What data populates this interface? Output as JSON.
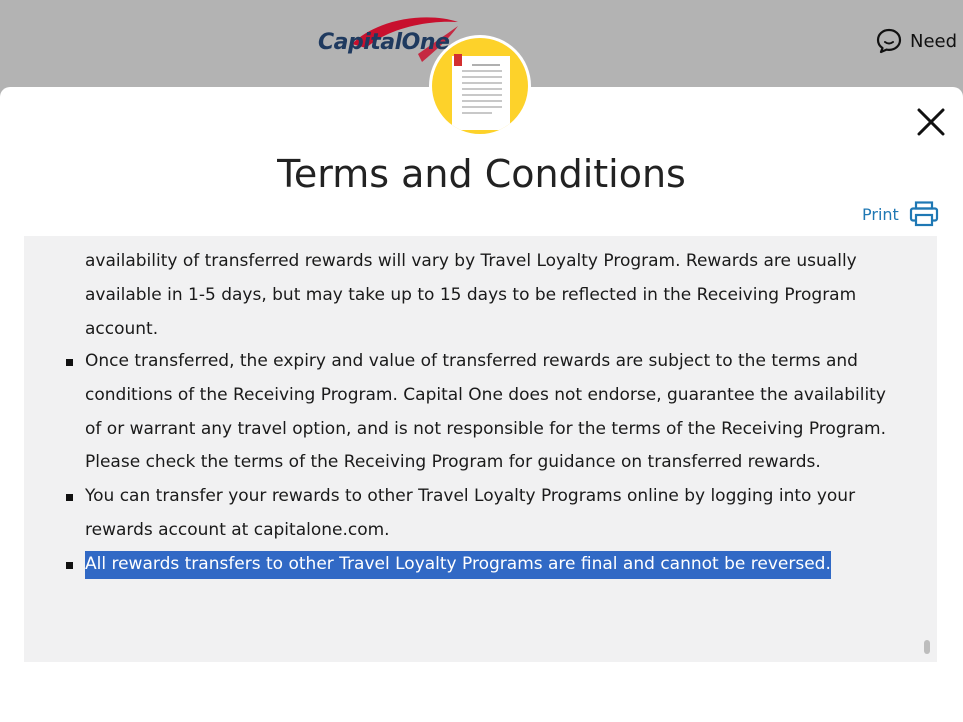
{
  "header": {
    "logo_text": "CapitalOne",
    "help_label": "Need",
    "brand_red": "#c8102e",
    "brand_navy": "#1f3a5f"
  },
  "modal": {
    "title": "Terms and Conditions",
    "print_label": "Print",
    "close_icon": "close-icon",
    "badge_icon": "document-icon",
    "badge_color": "#fdd22a",
    "link_color": "#1f78b4"
  },
  "terms": {
    "lead_text": "availability of transferred rewards will vary by Travel Loyalty Program. Rewards are usually available in 1-5 days, but may take up to 15 days to be reflected in the Receiving Program account.",
    "items": [
      "Once transferred, the expiry and value of transferred rewards are subject to the terms and conditions of the Receiving Program. Capital One does not endorse, guarantee the availability of or warrant any travel option, and is not responsible for the terms of the Receiving Program. Please check the terms of the Receiving Program for guidance on transferred rewards.",
      "You can transfer your rewards to other Travel Loyalty Programs online by logging into your rewards account at capitalone.com.",
      "All rewards transfers to other Travel Loyalty Programs are final and cannot be reversed."
    ],
    "selection_color": "#3169c5"
  }
}
